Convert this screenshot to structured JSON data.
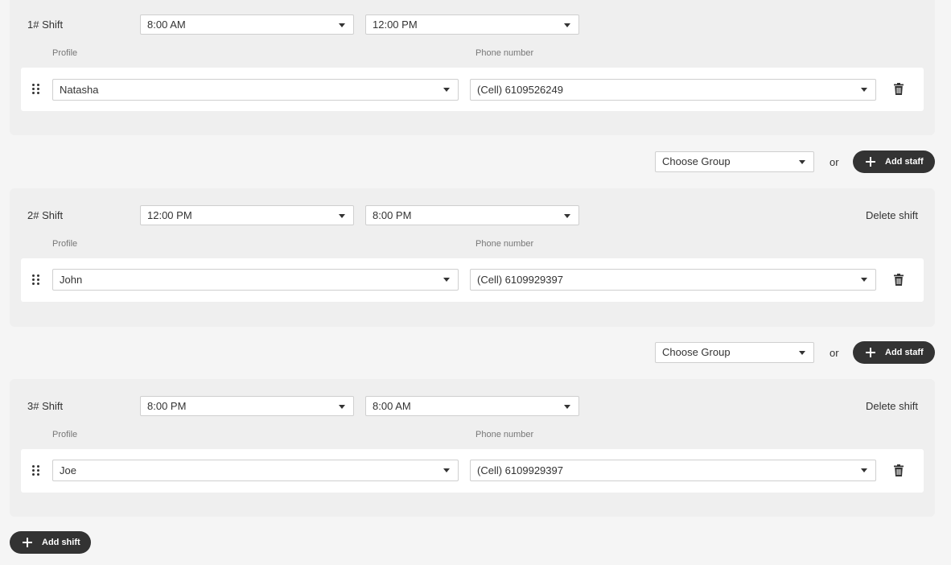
{
  "shifts": [
    {
      "title": "1# Shift",
      "start": "8:00 AM",
      "end": "12:00 PM",
      "profile_label": "Profile",
      "phone_label": "Phone number",
      "staff": {
        "profile": "Natasha",
        "phone": "(Cell) 6109526249"
      },
      "delete_label": ""
    },
    {
      "title": "2# Shift",
      "start": "12:00 PM",
      "end": "8:00 PM",
      "profile_label": "Profile",
      "phone_label": "Phone number",
      "staff": {
        "profile": "John",
        "phone": "(Cell) 6109929397"
      },
      "delete_label": "Delete shift"
    },
    {
      "title": "3# Shift",
      "start": "8:00 PM",
      "end": "8:00 AM",
      "profile_label": "Profile",
      "phone_label": "Phone number",
      "staff": {
        "profile": "Joe",
        "phone": "(Cell) 6109929397"
      },
      "delete_label": "Delete shift"
    }
  ],
  "group_rows": [
    {
      "group_value": "Choose Group",
      "or_text": "or",
      "add_staff_label": "Add staff"
    },
    {
      "group_value": "Choose Group",
      "or_text": "or",
      "add_staff_label": "Add staff"
    }
  ],
  "add_shift_label": "Add shift",
  "icons": {
    "drag": "drag-handle-icon",
    "trash": "trash-icon",
    "plus": "plus-icon",
    "caret": "chevron-down-icon"
  },
  "colors": {
    "page_bg": "#f5f5f5",
    "shift_bg": "#efefef",
    "card_bg": "#ffffff",
    "pill_bg": "#333333"
  }
}
